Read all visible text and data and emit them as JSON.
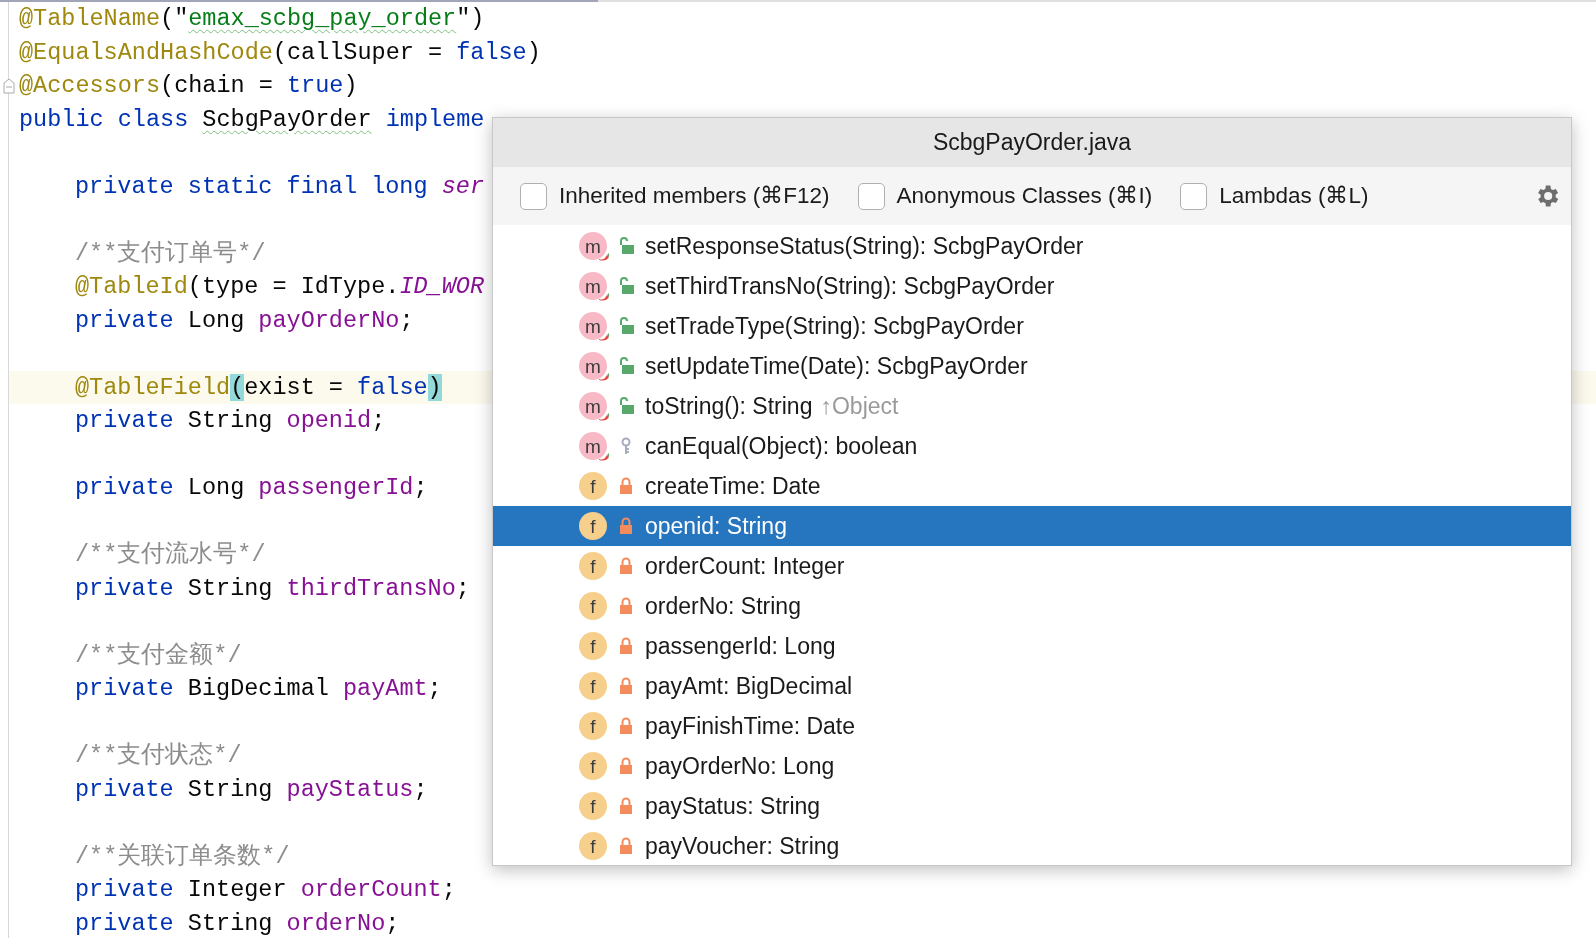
{
  "editor": {
    "lines": [
      {
        "kind": "code",
        "indented": false,
        "tokens": [
          {
            "kind": "annotation",
            "text": "@TableName"
          },
          {
            "kind": "plain",
            "text": "(\""
          },
          {
            "kind": "string",
            "text": "emax_scbg_pay_order",
            "typo": true
          },
          {
            "kind": "plain",
            "text": "\")"
          }
        ]
      },
      {
        "kind": "code",
        "indented": false,
        "tokens": [
          {
            "kind": "annotation",
            "text": "@EqualsAndHashCode"
          },
          {
            "kind": "plain",
            "text": "(callSuper = "
          },
          {
            "kind": "keyword",
            "text": "false"
          },
          {
            "kind": "plain",
            "text": ")"
          }
        ]
      },
      {
        "kind": "code",
        "indented": false,
        "folded": false,
        "tokens": [
          {
            "kind": "annotation",
            "text": "@Accessors"
          },
          {
            "kind": "plain",
            "text": "(chain = "
          },
          {
            "kind": "keyword",
            "text": "true"
          },
          {
            "kind": "plain",
            "text": ")"
          }
        ]
      },
      {
        "kind": "code",
        "indented": false,
        "tokens": [
          {
            "kind": "keyword",
            "text": "public class "
          },
          {
            "kind": "plain",
            "text": "ScbgPayOrder",
            "typo": true
          },
          {
            "kind": "keyword",
            "text": " impleme"
          }
        ]
      },
      {
        "kind": "blank"
      },
      {
        "kind": "code",
        "indented": true,
        "tokens": [
          {
            "kind": "keyword",
            "text": "private static final long "
          },
          {
            "kind": "constant",
            "text": "ser"
          }
        ]
      },
      {
        "kind": "blank"
      },
      {
        "kind": "code",
        "indented": true,
        "tokens": [
          {
            "kind": "comment",
            "text": "/**支付订单号*/"
          }
        ]
      },
      {
        "kind": "code",
        "indented": true,
        "tokens": [
          {
            "kind": "annotation",
            "text": "@TableId"
          },
          {
            "kind": "plain",
            "text": "(type = IdType."
          },
          {
            "kind": "constant",
            "text": "ID_WOR"
          }
        ]
      },
      {
        "kind": "code",
        "indented": true,
        "tokens": [
          {
            "kind": "keyword",
            "text": "private "
          },
          {
            "kind": "plain",
            "text": "Long "
          },
          {
            "kind": "field",
            "text": "payOrderNo"
          },
          {
            "kind": "plain",
            "text": ";"
          }
        ]
      },
      {
        "kind": "blank"
      },
      {
        "kind": "code",
        "indented": true,
        "current": true,
        "tokens": [
          {
            "kind": "annotation",
            "text": "@TableField"
          },
          {
            "kind": "brace",
            "text": "("
          },
          {
            "kind": "plain",
            "text": "exist = "
          },
          {
            "kind": "keyword",
            "text": "false"
          },
          {
            "kind": "brace",
            "text": ")"
          }
        ]
      },
      {
        "kind": "code",
        "indented": true,
        "tokens": [
          {
            "kind": "keyword",
            "text": "private "
          },
          {
            "kind": "plain",
            "text": "String "
          },
          {
            "kind": "field",
            "text": "openid"
          },
          {
            "kind": "plain",
            "text": ";"
          }
        ]
      },
      {
        "kind": "blank"
      },
      {
        "kind": "code",
        "indented": true,
        "tokens": [
          {
            "kind": "keyword",
            "text": "private "
          },
          {
            "kind": "plain",
            "text": "Long "
          },
          {
            "kind": "field",
            "text": "passengerId"
          },
          {
            "kind": "plain",
            "text": ";"
          }
        ]
      },
      {
        "kind": "blank"
      },
      {
        "kind": "code",
        "indented": true,
        "tokens": [
          {
            "kind": "comment",
            "text": "/**支付流水号*/"
          }
        ]
      },
      {
        "kind": "code",
        "indented": true,
        "tokens": [
          {
            "kind": "keyword",
            "text": "private "
          },
          {
            "kind": "plain",
            "text": "String "
          },
          {
            "kind": "field",
            "text": "thirdTransNo"
          },
          {
            "kind": "plain",
            "text": ";"
          }
        ]
      },
      {
        "kind": "blank"
      },
      {
        "kind": "code",
        "indented": true,
        "tokens": [
          {
            "kind": "comment",
            "text": "/**支付金额*/"
          }
        ]
      },
      {
        "kind": "code",
        "indented": true,
        "tokens": [
          {
            "kind": "keyword",
            "text": "private "
          },
          {
            "kind": "plain",
            "text": "BigDecimal "
          },
          {
            "kind": "field",
            "text": "payAmt"
          },
          {
            "kind": "plain",
            "text": ";"
          }
        ]
      },
      {
        "kind": "blank"
      },
      {
        "kind": "code",
        "indented": true,
        "tokens": [
          {
            "kind": "comment",
            "text": "/**支付状态*/"
          }
        ]
      },
      {
        "kind": "code",
        "indented": true,
        "tokens": [
          {
            "kind": "keyword",
            "text": "private "
          },
          {
            "kind": "plain",
            "text": "String "
          },
          {
            "kind": "field",
            "text": "payStatus"
          },
          {
            "kind": "plain",
            "text": ";"
          }
        ]
      },
      {
        "kind": "blank"
      },
      {
        "kind": "code",
        "indented": true,
        "tokens": [
          {
            "kind": "comment",
            "text": "/**关联订单条数*/"
          }
        ]
      },
      {
        "kind": "code",
        "indented": true,
        "tokens": [
          {
            "kind": "keyword",
            "text": "private "
          },
          {
            "kind": "plain",
            "text": "Integer "
          },
          {
            "kind": "field",
            "text": "orderCount"
          },
          {
            "kind": "plain",
            "text": ";"
          }
        ]
      },
      {
        "kind": "code",
        "indented": true,
        "tokens": [
          {
            "kind": "keyword",
            "text": "private "
          },
          {
            "kind": "plain",
            "text": "String "
          },
          {
            "kind": "field",
            "text": "orderNo"
          },
          {
            "kind": "plain",
            "text": ";"
          }
        ]
      }
    ]
  },
  "structure_popup": {
    "title": "ScbgPayOrder.java",
    "filters": [
      {
        "label": "Inherited members (⌘F12)",
        "checked": false
      },
      {
        "label": "Anonymous Classes (⌘I)",
        "checked": false
      },
      {
        "label": "Lambdas (⌘L)",
        "checked": false
      }
    ],
    "members": [
      {
        "kind": "public-method",
        "letter": "m",
        "text": "setResponseStatus(String): ScbgPayOrder",
        "selected": false
      },
      {
        "kind": "public-method",
        "letter": "m",
        "text": "setThirdTransNo(String): ScbgPayOrder",
        "selected": false
      },
      {
        "kind": "public-method",
        "letter": "m",
        "text": "setTradeType(String): ScbgPayOrder",
        "selected": false
      },
      {
        "kind": "public-method",
        "letter": "m",
        "text": "setUpdateTime(Date): ScbgPayOrder",
        "selected": false
      },
      {
        "kind": "public-method",
        "letter": "m",
        "text": "toString(): String",
        "origin": "↑Object",
        "selected": false
      },
      {
        "kind": "protected-method",
        "letter": "m",
        "text": "canEqual(Object): boolean",
        "selected": false
      },
      {
        "kind": "private-field",
        "letter": "f",
        "text": "createTime: Date",
        "selected": false
      },
      {
        "kind": "private-field",
        "letter": "f",
        "text": "openid: String",
        "selected": true
      },
      {
        "kind": "private-field",
        "letter": "f",
        "text": "orderCount: Integer",
        "selected": false
      },
      {
        "kind": "private-field",
        "letter": "f",
        "text": "orderNo: String",
        "selected": false
      },
      {
        "kind": "private-field",
        "letter": "f",
        "text": "passengerId: Long",
        "selected": false
      },
      {
        "kind": "private-field",
        "letter": "f",
        "text": "payAmt: BigDecimal",
        "selected": false
      },
      {
        "kind": "private-field",
        "letter": "f",
        "text": "payFinishTime: Date",
        "selected": false
      },
      {
        "kind": "private-field",
        "letter": "f",
        "text": "payOrderNo: Long",
        "selected": false
      },
      {
        "kind": "private-field",
        "letter": "f",
        "text": "payStatus: String",
        "selected": false
      },
      {
        "kind": "private-field",
        "letter": "f",
        "text": "payVoucher: String",
        "selected": false
      }
    ]
  }
}
